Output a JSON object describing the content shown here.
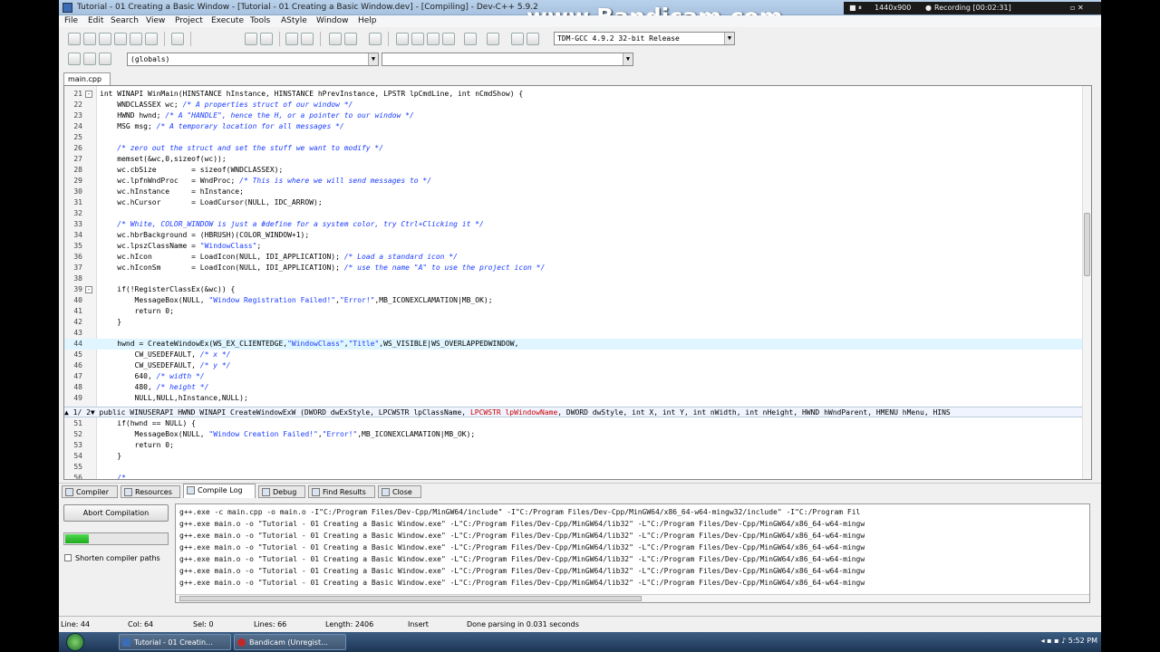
{
  "window": {
    "title": "Tutorial - 01 Creating a Basic Window - [Tutorial - 01 Creating a Basic Window.dev] - [Compiling] - Dev-C++ 5.9.2",
    "watermark": "www.Bandicam.com",
    "recording": {
      "resolution": "1440x900",
      "status": "Recording [00:02:31]"
    }
  },
  "menu": [
    "File",
    "Edit",
    "Search",
    "View",
    "Project",
    "Execute",
    "Tools",
    "AStyle",
    "Window",
    "Help"
  ],
  "toolbar": {
    "compiler": "TDM-GCC 4.9.2 32-bit Release",
    "scope": "(globals)",
    "member": ""
  },
  "file_tab": "main.cpp",
  "code_lines": [
    {
      "n": "21",
      "fold": "-",
      "t": "int WINAPI WinMain(HINSTANCE hInstance, HINSTANCE hPrevInstance, LPSTR lpCmdLine, int nCmdShow) {"
    },
    {
      "n": "22",
      "fold": "",
      "t": "    WNDCLASSEX wc; /* A properties struct of our window */"
    },
    {
      "n": "23",
      "fold": "",
      "t": "    HWND hwnd; /* A \"HANDLE\", hence the H, or a pointer to our window */"
    },
    {
      "n": "24",
      "fold": "",
      "t": "    MSG msg; /* A temporary location for all messages */"
    },
    {
      "n": "25",
      "fold": "",
      "t": ""
    },
    {
      "n": "26",
      "fold": "",
      "t": "    /* zero out the struct and set the stuff we want to modify */"
    },
    {
      "n": "27",
      "fold": "",
      "t": "    memset(&wc,0,sizeof(wc));"
    },
    {
      "n": "28",
      "fold": "",
      "t": "    wc.cbSize        = sizeof(WNDCLASSEX);"
    },
    {
      "n": "29",
      "fold": "",
      "t": "    wc.lpfnWndProc   = WndProc; /* This is where we will send messages to */"
    },
    {
      "n": "30",
      "fold": "",
      "t": "    wc.hInstance     = hInstance;"
    },
    {
      "n": "31",
      "fold": "",
      "t": "    wc.hCursor       = LoadCursor(NULL, IDC_ARROW);"
    },
    {
      "n": "32",
      "fold": "",
      "t": ""
    },
    {
      "n": "33",
      "fold": "",
      "t": "    /* White, COLOR_WINDOW is just a #define for a system color, try Ctrl+Clicking it */"
    },
    {
      "n": "34",
      "fold": "",
      "t": "    wc.hbrBackground = (HBRUSH)(COLOR_WINDOW+1);"
    },
    {
      "n": "35",
      "fold": "",
      "t": "    wc.lpszClassName = \"WindowClass\";"
    },
    {
      "n": "36",
      "fold": "",
      "t": "    wc.hIcon         = LoadIcon(NULL, IDI_APPLICATION); /* Load a standard icon */"
    },
    {
      "n": "37",
      "fold": "",
      "t": "    wc.hIconSm       = LoadIcon(NULL, IDI_APPLICATION); /* use the name \"A\" to use the project icon */"
    },
    {
      "n": "38",
      "fold": "",
      "t": ""
    },
    {
      "n": "39",
      "fold": "-",
      "t": "    if(!RegisterClassEx(&wc)) {"
    },
    {
      "n": "40",
      "fold": "",
      "t": "        MessageBox(NULL, \"Window Registration Failed!\",\"Error!\",MB_ICONEXCLAMATION|MB_OK);"
    },
    {
      "n": "41",
      "fold": "",
      "t": "        return 0;"
    },
    {
      "n": "42",
      "fold": "",
      "t": "    }"
    },
    {
      "n": "43",
      "fold": "",
      "t": ""
    },
    {
      "n": "44",
      "fold": "",
      "t": "    hwnd = CreateWindowEx(WS_EX_CLIENTEDGE,\"WindowClass\",\"Title\",WS_VISIBLE|WS_OVERLAPPEDWINDOW,",
      "cur": true
    },
    {
      "n": "45",
      "fold": "",
      "t": "        CW_USEDEFAULT, /* x */"
    },
    {
      "n": "46",
      "fold": "",
      "t": "        CW_USEDEFAULT, /* y */"
    },
    {
      "n": "47",
      "fold": "",
      "t": "        640, /* width */"
    },
    {
      "n": "48",
      "fold": "",
      "t": "        480, /* height */"
    },
    {
      "n": "49",
      "fold": "",
      "t": "        NULL,NULL,hInstance,NULL);"
    }
  ],
  "hint": {
    "prefix": "▲ 1/ 2▼ public WINUSERAPI HWND WINAPI CreateWindowExW (DWORD dwExStyle, LPCWSTR lpClassName, ",
    "highlight": "LPCWSTR lpWindowName",
    "suffix": ", DWORD dwStyle, int X, int Y, int nWidth, int nHeight, HWND hWndParent, HMENU hMenu, HINS"
  },
  "code_lines_after": [
    {
      "n": "51",
      "fold": "",
      "t": "    if(hwnd == NULL) {"
    },
    {
      "n": "52",
      "fold": "",
      "t": "        MessageBox(NULL, \"Window Creation Failed!\",\"Error!\",MB_ICONEXCLAMATION|MB_OK);"
    },
    {
      "n": "53",
      "fold": "",
      "t": "        return 0;"
    },
    {
      "n": "54",
      "fold": "",
      "t": "    }"
    },
    {
      "n": "55",
      "fold": "",
      "t": ""
    },
    {
      "n": "56",
      "fold": "",
      "t": "    /*"
    }
  ],
  "bottom_tabs": [
    "Compiler",
    "Resources",
    "Compile Log",
    "Debug",
    "Find Results",
    "Close"
  ],
  "log": {
    "abort_label": "Abort Compilation",
    "progress_fraction": 0.23,
    "shorten_label": "Shorten compiler paths",
    "lines": [
      "g++.exe -c main.cpp -o main.o -I\"C:/Program Files/Dev-Cpp/MinGW64/include\" -I\"C:/Program Files/Dev-Cpp/MinGW64/x86_64-w64-mingw32/include\" -I\"C:/Program Fil",
      "g++.exe main.o -o \"Tutorial - 01 Creating a Basic Window.exe\" -L\"C:/Program Files/Dev-Cpp/MinGW64/lib32\" -L\"C:/Program Files/Dev-Cpp/MinGW64/x86_64-w64-mingw",
      "g++.exe main.o -o \"Tutorial - 01 Creating a Basic Window.exe\" -L\"C:/Program Files/Dev-Cpp/MinGW64/lib32\" -L\"C:/Program Files/Dev-Cpp/MinGW64/x86_64-w64-mingw",
      "g++.exe main.o -o \"Tutorial - 01 Creating a Basic Window.exe\" -L\"C:/Program Files/Dev-Cpp/MinGW64/lib32\" -L\"C:/Program Files/Dev-Cpp/MinGW64/x86_64-w64-mingw",
      "g++.exe main.o -o \"Tutorial - 01 Creating a Basic Window.exe\" -L\"C:/Program Files/Dev-Cpp/MinGW64/lib32\" -L\"C:/Program Files/Dev-Cpp/MinGW64/x86_64-w64-mingw",
      "g++.exe main.o -o \"Tutorial - 01 Creating a Basic Window.exe\" -L\"C:/Program Files/Dev-Cpp/MinGW64/lib32\" -L\"C:/Program Files/Dev-Cpp/MinGW64/x86_64-w64-mingw",
      "g++.exe main.o -o \"Tutorial - 01 Creating a Basic Window.exe\" -L\"C:/Program Files/Dev-Cpp/MinGW64/lib32\" -L\"C:/Program Files/Dev-Cpp/MinGW64/x86_64-w64-mingw"
    ]
  },
  "status": {
    "line": "Line:  44",
    "col": "Col:  64",
    "sel": "Sel:  0",
    "lines": "Lines:  66",
    "length": "Length:  2406",
    "mode": "Insert",
    "message": "Done parsing in 0.031 seconds"
  },
  "taskbar": {
    "tasks": [
      "Tutorial - 01 Creatin...",
      "Bandicam (Unregist..."
    ],
    "clock": "5:52 PM"
  },
  "colors": {
    "accent": "#1a3cff",
    "current_line": "#dff5ff",
    "progress": "#1fa81f"
  }
}
